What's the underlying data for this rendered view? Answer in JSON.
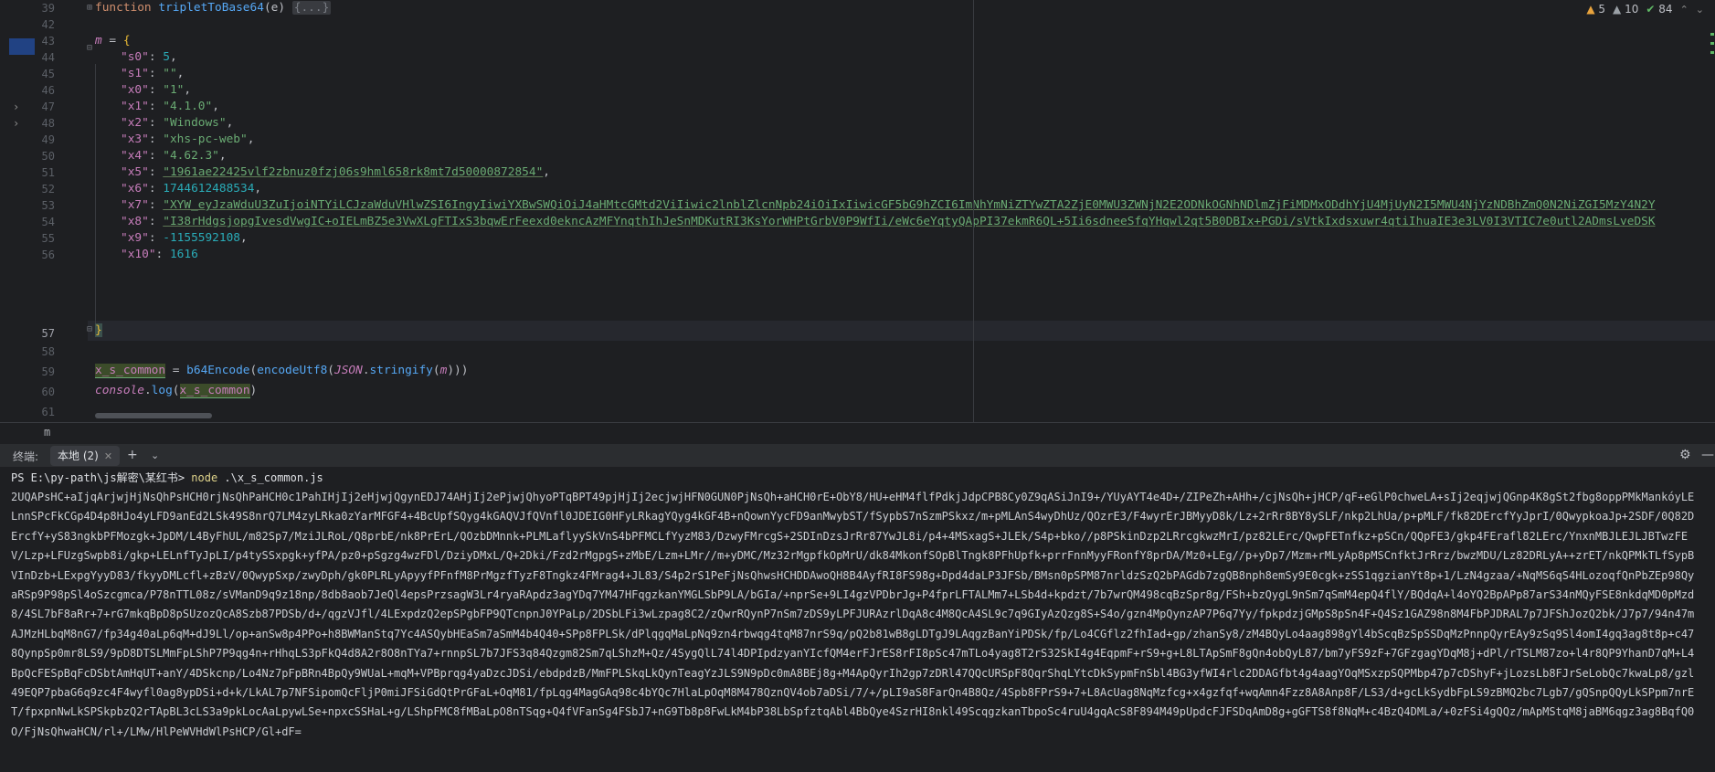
{
  "editor": {
    "line_numbers": [
      "39",
      "42",
      "43",
      "44",
      "45",
      "46",
      "47",
      "48",
      "49",
      "50",
      "51",
      "52",
      "53",
      "54",
      "55",
      "56",
      "57",
      "58",
      "59",
      "60",
      "61"
    ],
    "current_line": "57",
    "line39": {
      "kw": "function",
      "name": "tripletToBase64",
      "params": "(e) ",
      "folded": "{...}"
    },
    "line43": {
      "var": "m",
      "eq": " = ",
      "brace": "{"
    },
    "props": [
      {
        "key": "\"s0\"",
        "value": "5",
        "kind": "num",
        "comma": ","
      },
      {
        "key": "\"s1\"",
        "value": "\"\"",
        "kind": "str",
        "comma": ","
      },
      {
        "key": "\"x0\"",
        "value": "\"1\"",
        "kind": "str",
        "comma": ","
      },
      {
        "key": "\"x1\"",
        "value": "\"4.1.0\"",
        "kind": "str",
        "comma": ","
      },
      {
        "key": "\"x2\"",
        "value": "\"Windows\"",
        "kind": "str",
        "comma": ","
      },
      {
        "key": "\"x3\"",
        "value": "\"xhs-pc-web\"",
        "kind": "str",
        "comma": ","
      },
      {
        "key": "\"x4\"",
        "value": "\"4.62.3\"",
        "kind": "str",
        "comma": ","
      },
      {
        "key": "\"x5\"",
        "value": "\"1961ae22425vlf2zbnuz0fzj06s9hml658rk8mt7d50000872854\"",
        "kind": "str",
        "comma": ","
      },
      {
        "key": "\"x6\"",
        "value": "1744612488534",
        "kind": "num",
        "comma": ","
      },
      {
        "key": "\"x7\"",
        "value": "\"XYW_eyJzaWduU3ZuIjoiNTYiLCJzaWduVHlwZSI6IngyIiwiYXBwSWQiOiJ4aHMtcGMtd2ViIiwic2lnblZlcnNpb24iOiIxIiwicGF5bG9hZCI6ImNhYmNiZTYwZTA2ZjE0MWU3ZWNjN2E2ODNkOGNhNDlmZjFiMDMxODdhYjU4MjUyN2I5MWU4NjYzNDBhZmQ0N2NiZGI5MzY4N2Y",
        "kind": "str",
        "comma": ""
      },
      {
        "key": "\"x8\"",
        "value": "\"I38rHdgsjopgIvesdVwgIC+oIELmBZ5e3VwXLgFTIxS3bqwErFeexd0ekncAzMFYnqthIhJeSnMDKutRI3KsYorWHPtGrbV0P9WfIi/eWc6eYqtyQApPI37ekmR6QL+5Ii6sdneeSfqYHqwl2qt5B0DBIx+PGDi/sVtkIxdsxuwr4qtiIhuaIE3e3LV0I3VTIC7e0utl2ADmsLveDSK",
        "kind": "str",
        "comma": ""
      },
      {
        "key": "\"x9\"",
        "value": "-1155592108",
        "kind": "num",
        "comma": ","
      },
      {
        "key": "\"x10\"",
        "value": "1616",
        "kind": "num",
        "comma": ""
      }
    ],
    "line57": "}",
    "line59": {
      "var": "x_s_common",
      "eq": " = ",
      "f1": "b64Encode",
      "f2": "encodeUtf8",
      "obj": "JSON",
      "dot": ".",
      "f3": "stringify",
      "arg": "m",
      "close": "))"
    },
    "line60": {
      "obj": "console",
      "dot": ".",
      "f": "log",
      "arg": "x_s_common",
      "close": ")"
    },
    "inspections": {
      "warnings": "5",
      "weak": "10",
      "ok": "84"
    }
  },
  "breadcrumb": "m",
  "terminal": {
    "title": "终端:",
    "tab_label": "本地 (2)",
    "prompt": "PS E:\\py-path\\js解密\\某红书> ",
    "command": "node",
    "command_args": " .\\x_s_common.js",
    "output": "2UQAPsHC+aIjqArjwjHjNsQhPsHCH0rjNsQhPaHCH0c1PahIHjIj2eHjwjQgynEDJ74AHjIj2ePjwjQhyoPTqBPT49pjHjIj2ecjwjHFN0GUN0PjNsQh+aHCH0rE+ObY8/HU+eHM4flfPdkjJdpCPB8Cy0Z9qASiJnI9+/YUyAYT4e4D+/ZIPeZh+AHh+/cjNsQh+jHCP/qF+eGlP0chweLA+sIj2eqjwjQGnp4K8gSt2fbg8oppPMkMankóyLELnnSPcFkCGp4D4p8HJo4yLFD9anEd2LSk49S8nrQ7LM4zyLRka0zYarMFGF4+4BcUpfSQyg4kGAQVJfQVnfl0JDEIG0HFyLRkagYQyg4kGF4B+nQownYycFD9anMwybST/fSypbS7nSzmPSkxz/m+pMLAnS4wyDhUz/QOzrE3/F4wyrErJBMyyD8k/Lz+2rRr8BY8ySLF/nkp2LhUa/p+pMLF/fk82DErcfYyJprI/0QwypkoaJp+2SDF/0Q82DErcfY+yS83ngkbPFMozgk+JpDM/L4ByFhUL/m82Sp7/MziJLRoL/Q8prbE/nk8PrErL/QOzbDMnnk+PLMLaflyySkVnS4bPFMCLfYyzM83/DzwyFMrcgS+2SDInDzsJrRr87YwJL8i/p4+4MSxagS+JLEk/S4p+bko//p8PSkinDzp2LRrcgkwzMrI/pz82LErc/QwpFETnfkz+pSCn/QQpFE3/gkp4FErafl82LErc/YnxnMBJLEJLJBTwzFEV/Lzp+LFUzgSwpb8i/gkp+LELnfTyJpLI/p4tySSxpgk+yfPA/pz0+pSgzg4wzFDl/DziyDMxL/Q+2Dki/Fzd2rMgpgS+zMbE/Lzm+LMr//m+yDMC/Mz32rMgpfkOpMrU/dk84MkonfSOpBlTngk8PFhUpfk+prrFnnMyyFRonfY8prDA/Mz0+LEg//p+yDp7/Mzm+rMLyAp8pMSCnfktJrRrz/bwzMDU/Lz82DRLyA++zrET/nkQPMkTLfSypBVInDzb+LExpgYyyD83/fkyyDMLcfl+zBzV/0QwypSxp/zwyDph/gk0PLRLyApyyfPFnfM8PrMgzfTyzF8Tngkz4FMrag4+JL83/S4p2rS1PeFjNsQhwsHCHDDAwoQH8B4AyfRI8FS98g+Dpd4daLP3JFSb/BMsn0pSPM87nrldzSzQ2bPAGdb7zgQB8nph8emSy9E0cgk+zSS1qgzianYt8p+1/LzN4gzaa/+NqMS6qS4HLozoqfQnPbZEp98QyaRSp9P98pSl4oSzcgmca/P78nTTL08z/sVManD9q9z18np/8db8aob7JeQl4epsPrzsagW3Lr4ryaRApdz3agYDq7YM47HFqgzkanYMGLSbP9LA/bGIa/+nprSe+9LI4gzVPDbrJg+P4fprLFTALMm7+LSb4d+kpdzt/7b7wrQM498cqBzSpr8g/FSh+bzQygL9nSm7qSmM4epQ4flY/BQdqA+l4oYQ2BpAPp87arS34nMQyFSE8nkdqMD0pMzd8/4SL7bF8aRr+7+rG7mkqBpD8pSUzozQcA8Szb87PDSb/d+/qgzVJfl/4LExpdzQ2epSPgbFP9QTcnpnJ0YPaLp/2DSbLFi3wLzpag8C2/zQwrRQynP7nSm7zDS9yLPFJURAzrlDqA8c4M8QcA4SL9c7q9GIyAzQzg8S+S4o/gzn4MpQynzAP7P6q7Yy/fpkpdzjGMpS8pSn4F+Q4Sz1GAZ98n8M4FbPJDRAL7p7JFShJozQ2bk/J7p7/94n47mAJMzHLbqM8nG7/fp34g40aLp6qM+dJ9Ll/op+anSw8p4PPo+h8BWManStq7Yc4ASQybHEaSm7aSmM4b4Q40+SPp8FPLSk/dPlqgqMaLpNq9zn4rbwqg4tqM87nrS9q/pQ2b81wB8gLDTgJ9LAqgzBanYiPDSk/fp/Lo4CGflz2fhIad+gp/zhanSy8/zM4BQyLo4aag898gYl4bScqBzSpSSDqMzPnnpQyrEAy9zSq9Sl4omI4gq3ag8t8p+c478QynpSp0mr8LS9/9pD8DTSLMmFpLShP7P9qg4n+rHhqLS3pFkQ4d8A2r8O8nTYa7+rnnpSL7b7JFS3q84Qzgm82Sm7qLShzM+Qz/4SygQlL74l4DPIpdzyanYIcfQM4erFJrES8rFI8pSc47mTLo4yag8T2rS32SkI4g4EqpmF+rS9+g+L8LTApSmF8gQn4obQyL87/bm7yFS9zF+7GFzgagYDqM8j+dPl/rTSLM87zo+l4r8QP9YhanD7qM+L4BpQcFESpBqFcDSbtAmHqUT+anY/4DSkcnp/Lo4Nz7pFpBRn4BpQy9WUaL+mqM+VPBprqg4yaDzcJDSi/ebdpdzB/MmFPLSkqLkQynTeagYzJLS9N9pDc0mA8BEj8g+M4ApQyrIh2gp7zDRl47QQcURSpF8QqrShqLYtcDkSypmFnSbl4BG3yfWI4rlc2DDAGfbt4g4aagYOqMSxzpSQPMbp47p7cDShyF+jLozsLb8FJrSeLobQc7kwaLp8/gzl49EQP7pbaG6q9zc4F4wyfl0ag8ypDSi+d+k/LkAL7p7NFSipomQcFljP0miJFSiGdQtPrGFaL+OqM81/fpLqg4MagGAq98c4bYQc7HlaLpOqM8M478QznQV4ob7aDSi/7/+/pLI9aS8FarQn4B8Qz/4Spb8FPrS9+7+L8AcUag8NqMzfcg+x4gzfqf+wqAmn4Fzz8A8Anp8F/LS3/d+gcLkSydbFpLS9zBMQ2bc7Lgb7/gQSnpQQyLkSPpm7nrET/fpxpnNwLkSPSkpbzQ2rTApBL3cLS3a9pkLocAaLpywLSe+npxcSSHaL+g/LShpFMC8fMBaLpO8nTSqg+Q4fVFanSg4FSbJ7+nG9Tb8p8FwLkM4bP38LbSpfztqAbl4BbQye4SzrHI8nkl49ScqgzkanTbpoSc4ruU4gqAcS8F894M49pUpdcFJFSDqAmD8g+gGFTS8f8NqM+c4BzQ4DMLa/+0zFSi4gQQz/mApMStqM8jaBM6qgz3ag8BqfQ0O/FjNsQhwaHCN/rl+/LMw/HlPeWVHdWlPsHCP/Gl+dF="
  }
}
